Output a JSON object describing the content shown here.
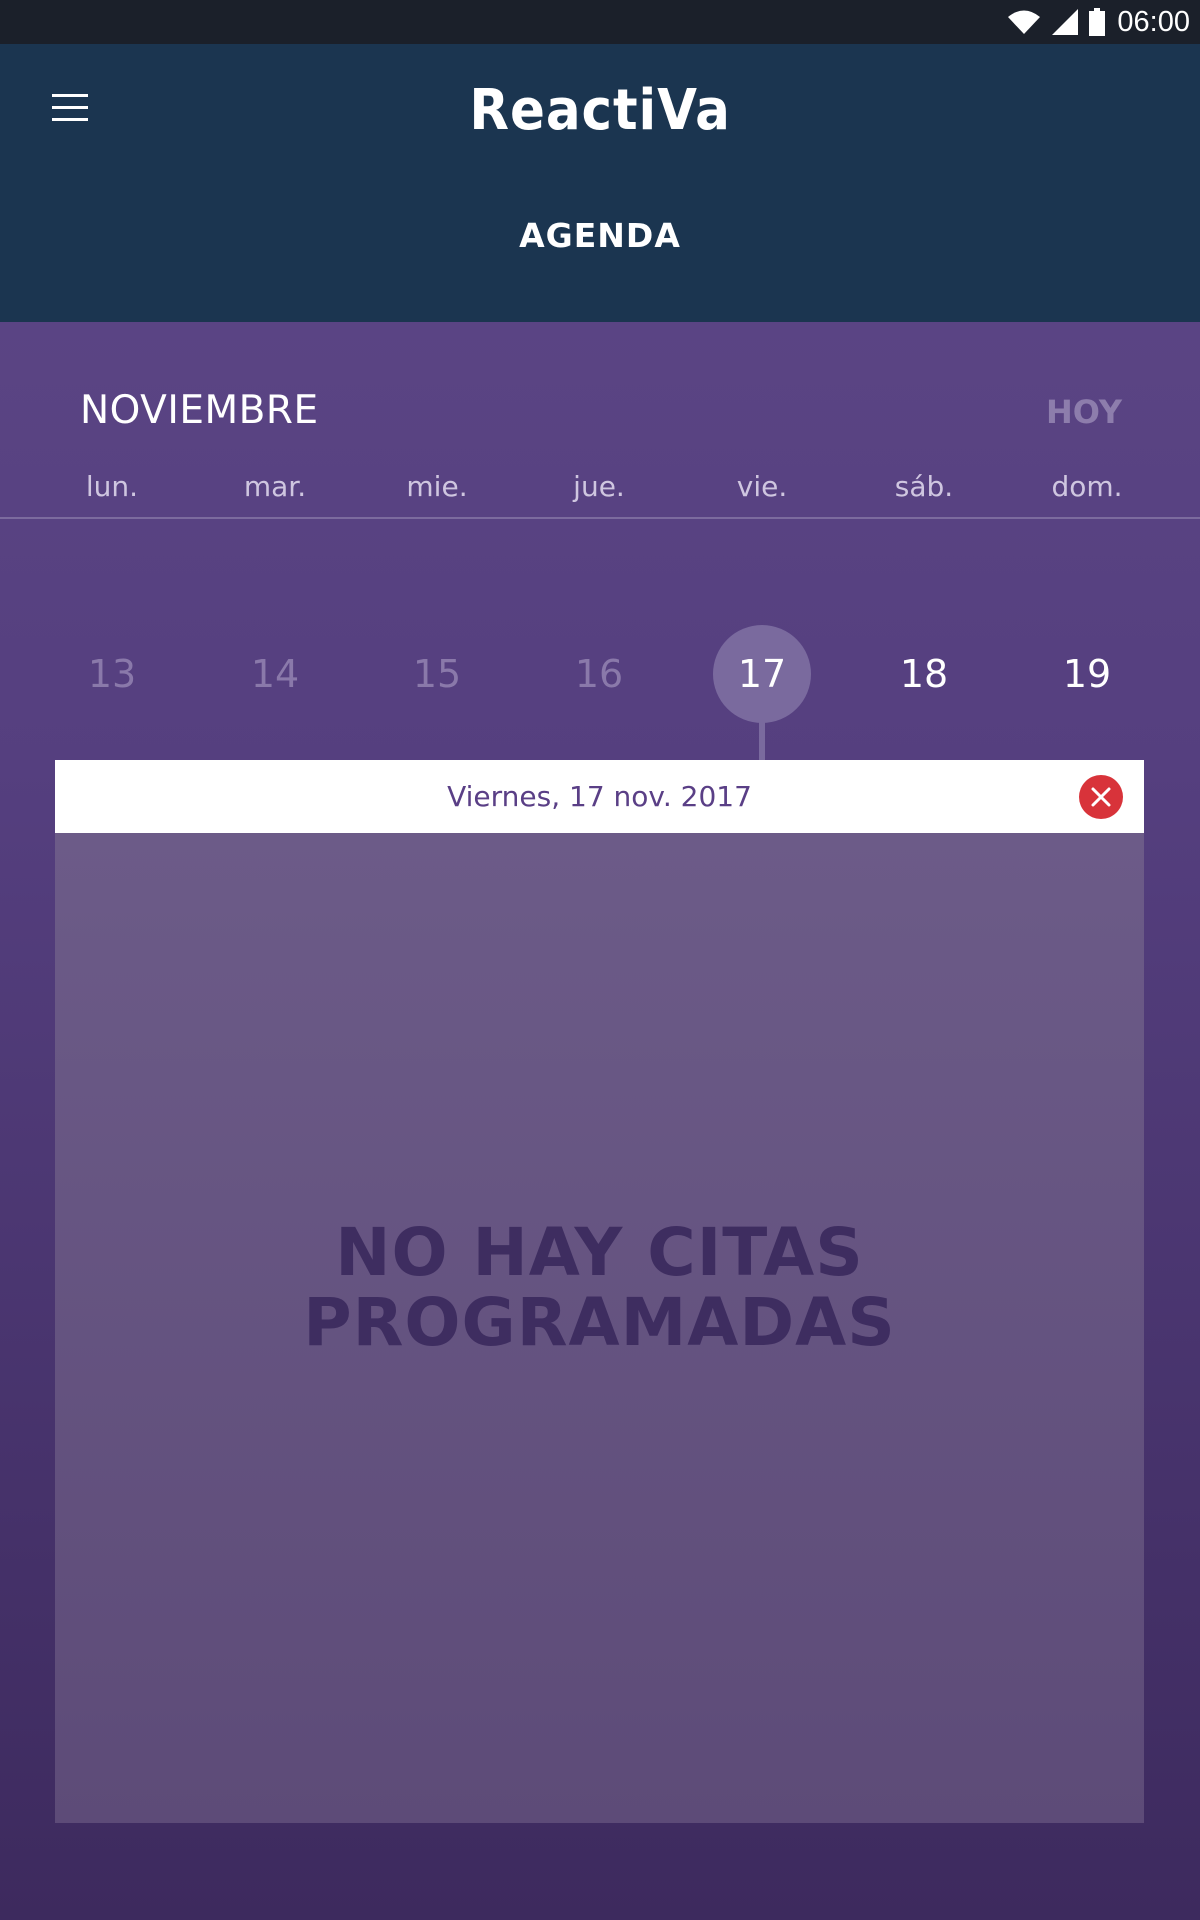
{
  "status_bar": {
    "time": "06:00",
    "icons": [
      "wifi-icon",
      "signal-icon",
      "battery-icon"
    ]
  },
  "header": {
    "brand": "ReactiVa",
    "title": "AGENDA"
  },
  "calendar": {
    "month": "NOVIEMBRE",
    "today_label": "HOY",
    "weekdays": [
      "lun.",
      "mar.",
      "mie.",
      "jue.",
      "vie.",
      "sáb.",
      "dom."
    ],
    "days": [
      {
        "num": "13",
        "state": "past"
      },
      {
        "num": "14",
        "state": "past"
      },
      {
        "num": "15",
        "state": "past"
      },
      {
        "num": "16",
        "state": "past"
      },
      {
        "num": "17",
        "state": "selected"
      },
      {
        "num": "18",
        "state": "future"
      },
      {
        "num": "19",
        "state": "future"
      }
    ]
  },
  "detail": {
    "date_label": "Viernes, 17 nov. 2017",
    "empty_line1": "NO HAY CITAS",
    "empty_line2": "PROGRAMADAS"
  },
  "colors": {
    "header_bg": "#1b3550",
    "accent_purple": "#5e4887",
    "close_red": "#d8333a"
  }
}
